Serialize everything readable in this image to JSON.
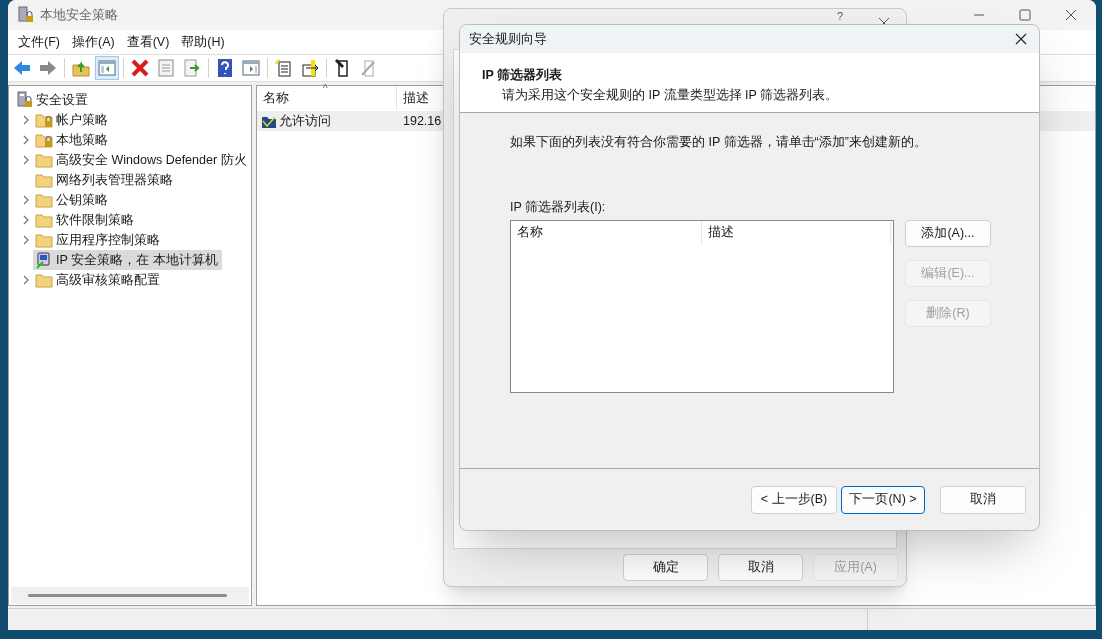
{
  "main_window": {
    "title": "本地安全策略",
    "menu": [
      "文件(F)",
      "操作(A)",
      "查看(V)",
      "帮助(H)"
    ],
    "toolbar": [
      {
        "kind": "back"
      },
      {
        "kind": "forward"
      },
      {
        "kind": "separator"
      },
      {
        "kind": "up"
      },
      {
        "kind": "tree",
        "pressed": true
      },
      {
        "kind": "separator"
      },
      {
        "kind": "delete"
      },
      {
        "kind": "properties"
      },
      {
        "kind": "export"
      },
      {
        "kind": "separator"
      },
      {
        "kind": "help"
      },
      {
        "kind": "pane"
      },
      {
        "kind": "separator"
      },
      {
        "kind": "new"
      },
      {
        "kind": "add"
      },
      {
        "kind": "separator"
      },
      {
        "kind": "assign"
      },
      {
        "kind": "unassign"
      }
    ],
    "tree": [
      {
        "label": "安全设置",
        "kind": "root",
        "has_children": false,
        "selected": false,
        "children": [
          {
            "label": "帐户策略",
            "kind": "locked",
            "has_children": true,
            "selected": false
          },
          {
            "label": "本地策略",
            "kind": "locked",
            "has_children": true,
            "selected": false
          },
          {
            "label": "高级安全 Windows Defender 防火",
            "kind": "folder",
            "has_children": true,
            "selected": false
          },
          {
            "label": "网络列表管理器策略",
            "kind": "folder",
            "has_children": false,
            "selected": false
          },
          {
            "label": "公钥策略",
            "kind": "folder",
            "has_children": true,
            "selected": false
          },
          {
            "label": "软件限制策略",
            "kind": "folder",
            "has_children": true,
            "selected": false
          },
          {
            "label": "应用程序控制策略",
            "kind": "folder",
            "has_children": true,
            "selected": false
          },
          {
            "label": "IP 安全策略，在 本地计算机",
            "kind": "ip",
            "has_children": false,
            "selected": true
          },
          {
            "label": "高级审核策略配置",
            "kind": "folder",
            "has_children": true,
            "selected": false
          }
        ]
      }
    ],
    "list": {
      "sort_mark": "^",
      "columns": [
        "名称",
        "描述"
      ],
      "rows": [
        {
          "name": "允许访问",
          "description": "192.16",
          "selected": true
        }
      ]
    }
  },
  "properties_dialog": {
    "help": "?",
    "buttons": [
      {
        "label": "确定",
        "disabled": false
      },
      {
        "label": "取消",
        "disabled": false
      },
      {
        "label": "应用(A)",
        "disabled": true
      }
    ]
  },
  "wizard": {
    "title": "安全规则向导",
    "header_title": "IP 筛选器列表",
    "header_subtitle": "请为采用这个安全规则的 IP 流量类型选择 IP 筛选器列表。",
    "instruction": "如果下面的列表没有符合你需要的 IP 筛选器，请单击“添加”来创建新的。",
    "list_label": "IP 筛选器列表(I):",
    "list_columns": [
      "名称",
      "描述"
    ],
    "side_buttons": [
      {
        "label": "添加(A)...",
        "disabled": false
      },
      {
        "label": "编辑(E)...",
        "disabled": true
      },
      {
        "label": "删除(R)",
        "disabled": true
      }
    ],
    "nav_buttons": [
      {
        "label": "< 上一步(B)",
        "default": false
      },
      {
        "label": "下一页(N) >",
        "default": true
      },
      {
        "label": "取消",
        "default": false
      }
    ]
  }
}
